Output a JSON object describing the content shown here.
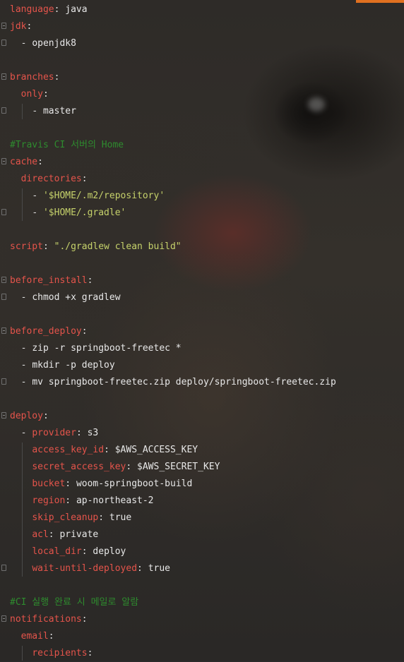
{
  "editor": {
    "lines": [
      {
        "indent": "",
        "key": "language",
        "sep": ": ",
        "value": "java",
        "kind": "plain"
      },
      {
        "indent": "",
        "key": "jdk",
        "sep": ":",
        "value": "",
        "kind": "plain"
      },
      {
        "indent": "  ",
        "dash": "- ",
        "value": "openjdk8",
        "kind": "plain"
      },
      {
        "indent": "",
        "value": "",
        "kind": "blank"
      },
      {
        "indent": "",
        "key": "branches",
        "sep": ":",
        "value": "",
        "kind": "plain"
      },
      {
        "indent": "  ",
        "key": "only",
        "sep": ":",
        "value": "",
        "kind": "plain"
      },
      {
        "indent": "    ",
        "dash": "- ",
        "value": "master",
        "kind": "plain"
      },
      {
        "indent": "",
        "value": "",
        "kind": "blank"
      },
      {
        "indent": "",
        "comment": "#Travis CI 서버의 Home",
        "kind": "comment"
      },
      {
        "indent": "",
        "key": "cache",
        "sep": ":",
        "value": "",
        "kind": "plain"
      },
      {
        "indent": "  ",
        "key": "directories",
        "sep": ":",
        "value": "",
        "kind": "plain"
      },
      {
        "indent": "    ",
        "dash": "- ",
        "value": "'$HOME/.m2/repository'",
        "kind": "string"
      },
      {
        "indent": "    ",
        "dash": "- ",
        "value": "'$HOME/.gradle'",
        "kind": "string"
      },
      {
        "indent": "",
        "value": "",
        "kind": "blank"
      },
      {
        "indent": "",
        "key": "script",
        "sep": ": ",
        "value": "\"./gradlew clean build\"",
        "kind": "string"
      },
      {
        "indent": "",
        "value": "",
        "kind": "blank"
      },
      {
        "indent": "",
        "key": "before_install",
        "sep": ":",
        "value": "",
        "kind": "plain"
      },
      {
        "indent": "  ",
        "dash": "- ",
        "value": "chmod +x gradlew",
        "kind": "plain"
      },
      {
        "indent": "",
        "value": "",
        "kind": "blank"
      },
      {
        "indent": "",
        "key": "before_deploy",
        "sep": ":",
        "value": "",
        "kind": "plain"
      },
      {
        "indent": "  ",
        "dash": "- ",
        "value": "zip -r springboot-freetec *",
        "kind": "plain"
      },
      {
        "indent": "  ",
        "dash": "- ",
        "value": "mkdir -p deploy",
        "kind": "plain"
      },
      {
        "indent": "  ",
        "dash": "- ",
        "value": "mv springboot-freetec.zip deploy/springboot-freetec.zip",
        "kind": "plain"
      },
      {
        "indent": "",
        "value": "",
        "kind": "blank"
      },
      {
        "indent": "",
        "key": "deploy",
        "sep": ":",
        "value": "",
        "kind": "plain"
      },
      {
        "indent": "  ",
        "dash": "- ",
        "key": "provider",
        "sep": ": ",
        "value": "s3",
        "kind": "plain"
      },
      {
        "indent": "    ",
        "key": "access_key_id",
        "sep": ": ",
        "value": "$AWS_ACCESS_KEY",
        "kind": "plain"
      },
      {
        "indent": "    ",
        "key": "secret_access_key",
        "sep": ": ",
        "value": "$AWS_SECRET_KEY",
        "kind": "plain"
      },
      {
        "indent": "    ",
        "key": "bucket",
        "sep": ": ",
        "value": "woom-springboot-build",
        "kind": "plain"
      },
      {
        "indent": "    ",
        "key": "region",
        "sep": ": ",
        "value": "ap-northeast-2",
        "kind": "plain"
      },
      {
        "indent": "    ",
        "key": "skip_cleanup",
        "sep": ": ",
        "value": "true",
        "kind": "plain"
      },
      {
        "indent": "    ",
        "key": "acl",
        "sep": ": ",
        "value": "private",
        "kind": "plain"
      },
      {
        "indent": "    ",
        "key": "local_dir",
        "sep": ": ",
        "value": "deploy",
        "kind": "plain"
      },
      {
        "indent": "    ",
        "key": "wait-until-deployed",
        "sep": ": ",
        "value": "true",
        "kind": "plain"
      },
      {
        "indent": "",
        "value": "",
        "kind": "blank"
      },
      {
        "indent": "",
        "comment": "#CI 실행 완료 시 메일로 알람",
        "kind": "comment"
      },
      {
        "indent": "",
        "key": "notifications",
        "sep": ":",
        "value": "",
        "kind": "plain"
      },
      {
        "indent": "  ",
        "key": "email",
        "sep": ":",
        "value": "",
        "kind": "plain"
      },
      {
        "indent": "    ",
        "key": "recipients",
        "sep": ":",
        "value": "",
        "kind": "plain"
      }
    ]
  },
  "colors": {
    "key": "#e5544b",
    "string": "#c6d26b",
    "comment": "#2e8b2e",
    "plain": "#e8e8e8",
    "scroll_accent": "#e07020"
  }
}
